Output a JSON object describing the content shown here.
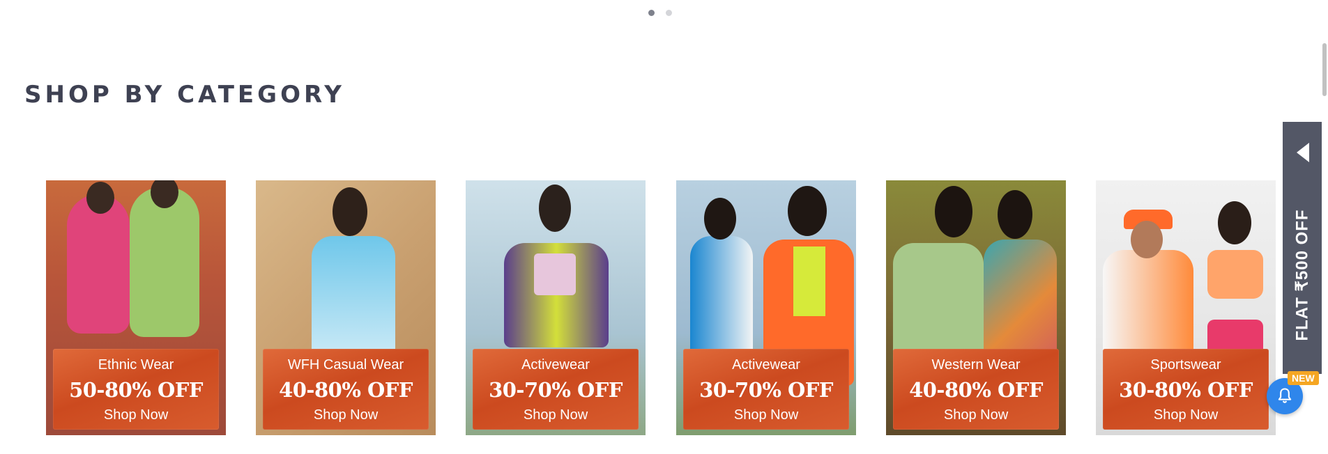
{
  "carousel": {
    "slide_count": 2,
    "active_index": 0
  },
  "section": {
    "title": "SHOP BY CATEGORY"
  },
  "categories": [
    {
      "name": "Ethnic Wear",
      "discount": "50-80% OFF",
      "cta": "Shop Now"
    },
    {
      "name": "WFH Casual Wear",
      "discount": "40-80% OFF",
      "cta": "Shop Now"
    },
    {
      "name": "Activewear",
      "discount": "30-70% OFF",
      "cta": "Shop Now"
    },
    {
      "name": "Activewear",
      "discount": "30-70% OFF",
      "cta": "Shop Now"
    },
    {
      "name": "Western Wear",
      "discount": "40-80% OFF",
      "cta": "Shop Now"
    },
    {
      "name": "Sportswear",
      "discount": "30-80% OFF",
      "cta": "Shop Now"
    }
  ],
  "side_offer": {
    "label": "FLAT ₹500 OFF",
    "icon": "triangle-left-icon"
  },
  "notifications": {
    "badge": "NEW",
    "icon": "bell-icon"
  },
  "colors": {
    "offer_tab": "#535766",
    "card_overlay": "#d5552a",
    "bell": "#2f86eb",
    "badge": "#f5a623"
  }
}
